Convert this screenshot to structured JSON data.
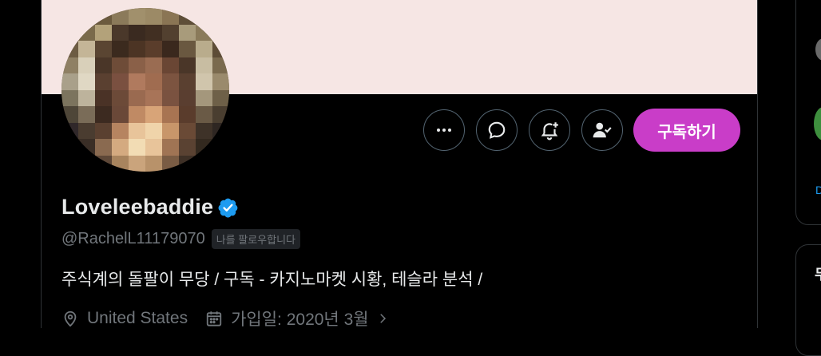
{
  "profile": {
    "display_name": "Loveleebaddie",
    "handle": "@RachelL11179070",
    "follows_you_badge": "나를 팔로우합니다",
    "bio": "주식계의 돌팔이 무당 / 구독 - 카지노마켓 시황, 테슬라 분석 /",
    "location": "United States",
    "joined": "가입일: 2020년 3월",
    "verified": true,
    "banner_color": "#f6e6e4"
  },
  "actions": {
    "more_icon": "more-horizontal-icon",
    "message_icon": "message-bubble-icon",
    "notify_icon": "bell-add-icon",
    "follow_icon": "user-check-icon",
    "subscribe_label": "구독하기",
    "subscribe_color": "#c93dc8"
  },
  "sidebar": {
    "link_text": "D",
    "heading_text": "무"
  },
  "colors": {
    "accent": "#1d9bf0",
    "muted": "#71767b",
    "text": "#e7e9ea"
  }
}
